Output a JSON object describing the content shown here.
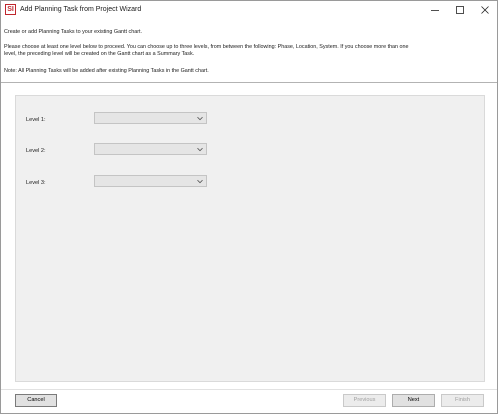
{
  "window": {
    "title": "Add Planning Task from Project Wizard",
    "app_icon_text": "SI",
    "controls": {
      "minimize": "minimize-icon",
      "maximize": "maximize-icon",
      "close": "close-icon"
    }
  },
  "intro": {
    "line1": "Create or add Planning Tasks to your existing Gantt chart.",
    "line2": "Please choose at least one level below to proceed. You can choose up to three levels, from between the following: Phase, Location, System. If you choose more than one",
    "line3": "level, the preceding level will be created on the Gantt chart as a Summary Task.",
    "note": "Note: All Planning Tasks will be added after existing Planning Tasks in the Gantt chart."
  },
  "levels": [
    {
      "label": "Level 1:",
      "value": ""
    },
    {
      "label": "Level 2:",
      "value": ""
    },
    {
      "label": "Level 3:",
      "value": ""
    }
  ],
  "buttons": {
    "cancel": "Cancel",
    "previous": "Previous",
    "next": "Next",
    "finish": "Finish"
  },
  "colors": {
    "accent": "#c0262d",
    "panel_bg": "#f0f0f0",
    "combo_bg": "#e5e5e5",
    "disabled_text": "#a0a0a0"
  }
}
